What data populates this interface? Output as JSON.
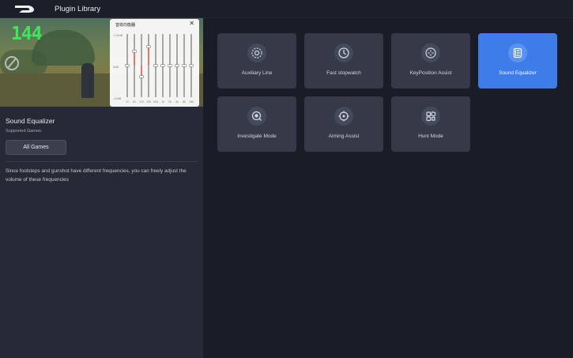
{
  "header": {
    "title": "Plugin Library"
  },
  "preview": {
    "fps": "144",
    "equalizer": {
      "title": "音效均衡器",
      "close": "✕",
      "db_labels": [
        "+10dB",
        "0dB",
        "-10dB"
      ],
      "freq_labels": [
        "31",
        "62",
        "125",
        "250",
        "500",
        "1k",
        "2k",
        "4k",
        "8k",
        "16k"
      ],
      "levels": [
        0,
        0.45,
        -0.35,
        0.6,
        0,
        0,
        0,
        0,
        0,
        0
      ]
    }
  },
  "detail": {
    "title": "Sound Equalizer",
    "supported_label": "Supported Games:",
    "games_button": "All Games",
    "description": "Since footsteps and gunshot have different frequencies, you can freely adjust the volume of these frequencies"
  },
  "plugins": [
    {
      "label": "Auxiliary Line",
      "icon": "auxiliary-line-icon",
      "active": false
    },
    {
      "label": "Fast stopwatch",
      "icon": "stopwatch-icon",
      "active": false
    },
    {
      "label": "KeyPosition Assist",
      "icon": "keyposition-icon",
      "active": false
    },
    {
      "label": "Sound Equalizer",
      "icon": "equalizer-icon",
      "active": true
    },
    {
      "label": "Investigate Mode",
      "icon": "investigate-icon",
      "active": false
    },
    {
      "label": "Aiming Assist",
      "icon": "crosshair-icon",
      "active": false
    },
    {
      "label": "Hunt Mode",
      "icon": "hunt-mode-icon",
      "active": false
    }
  ],
  "colors": {
    "accent": "#3e7cea",
    "fps": "#3ee65e",
    "eq_active": "#e53b3b"
  }
}
